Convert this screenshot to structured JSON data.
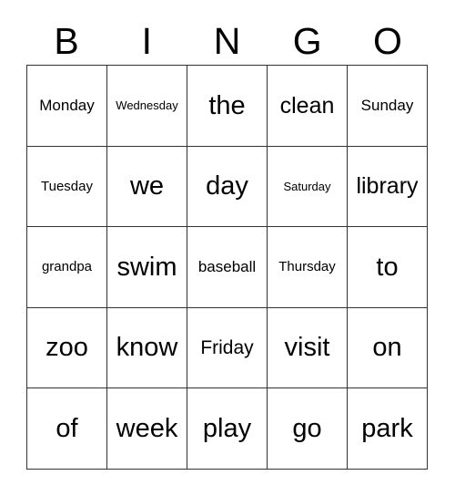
{
  "card": {
    "type": "bingo-card",
    "header_letters": [
      "B",
      "I",
      "N",
      "G",
      "O"
    ],
    "columns": 5,
    "rows": 5,
    "border_color": "#333333",
    "background_color": "#ffffff",
    "text_color": "#000000",
    "cells": [
      [
        {
          "text": "Monday",
          "size": "m"
        },
        {
          "text": "Wednesday",
          "size": "xs"
        },
        {
          "text": "the",
          "size": "xxl"
        },
        {
          "text": "clean",
          "size": "xl"
        },
        {
          "text": "Sunday",
          "size": "m"
        }
      ],
      [
        {
          "text": "Tuesday",
          "size": "s"
        },
        {
          "text": "we",
          "size": "xxl"
        },
        {
          "text": "day",
          "size": "xxl"
        },
        {
          "text": "Saturday",
          "size": "xs"
        },
        {
          "text": "library",
          "size": "xl"
        }
      ],
      [
        {
          "text": "grandpa",
          "size": "s"
        },
        {
          "text": "swim",
          "size": "xxl"
        },
        {
          "text": "baseball",
          "size": "m"
        },
        {
          "text": "Thursday",
          "size": "s"
        },
        {
          "text": "to",
          "size": "xxl"
        }
      ],
      [
        {
          "text": "zoo",
          "size": "xxl"
        },
        {
          "text": "know",
          "size": "xxl"
        },
        {
          "text": "Friday",
          "size": "l"
        },
        {
          "text": "visit",
          "size": "xxl"
        },
        {
          "text": "on",
          "size": "xxl"
        }
      ],
      [
        {
          "text": "of",
          "size": "xxl"
        },
        {
          "text": "week",
          "size": "xxl"
        },
        {
          "text": "play",
          "size": "xxl"
        },
        {
          "text": "go",
          "size": "xxl"
        },
        {
          "text": "park",
          "size": "xxl"
        }
      ]
    ]
  }
}
